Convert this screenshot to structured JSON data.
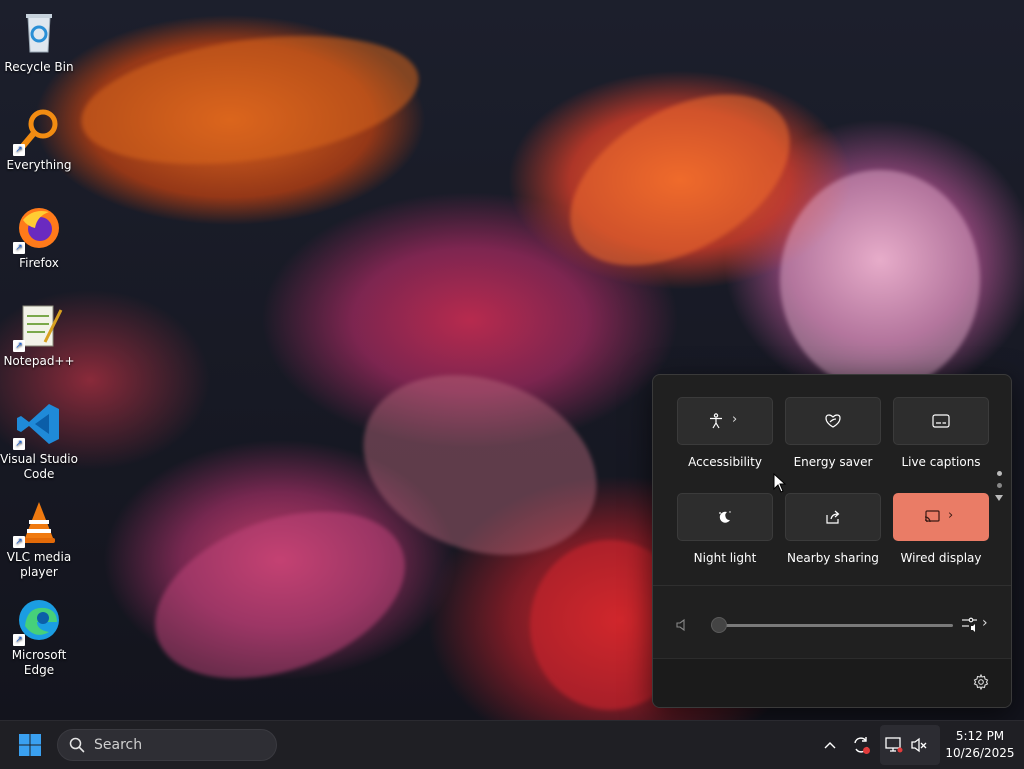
{
  "desktop": {
    "icons": [
      {
        "label": "Recycle Bin",
        "icon": "recycle-bin-icon"
      },
      {
        "label": "Everything",
        "icon": "everything-search-icon"
      },
      {
        "label": "Firefox",
        "icon": "firefox-icon"
      },
      {
        "label": "Notepad++",
        "icon": "notepad-plus-plus-icon"
      },
      {
        "label": "Visual Studio Code",
        "icon": "vscode-icon"
      },
      {
        "label": "VLC media player",
        "icon": "vlc-icon"
      },
      {
        "label": "Microsoft Edge",
        "icon": "edge-icon"
      }
    ]
  },
  "quick_settings": {
    "tiles": [
      {
        "label": "Accessibility",
        "icon": "accessibility-icon",
        "active": false,
        "has_chevron": true
      },
      {
        "label": "Energy saver",
        "icon": "energy-saver-icon",
        "active": false,
        "has_chevron": false
      },
      {
        "label": "Live captions",
        "icon": "live-captions-icon",
        "active": false,
        "has_chevron": false
      },
      {
        "label": "Night light",
        "icon": "night-light-icon",
        "active": false,
        "has_chevron": false
      },
      {
        "label": "Nearby sharing",
        "icon": "nearby-sharing-icon",
        "active": false,
        "has_chevron": false
      },
      {
        "label": "Wired display",
        "icon": "wired-display-icon",
        "active": true,
        "has_chevron": true
      }
    ],
    "volume": {
      "level": 0,
      "icon": "speaker-icon",
      "mixer_icon": "audio-mixer-icon"
    },
    "footer": {
      "settings_icon": "gear-icon"
    },
    "colors": {
      "panel": "#202020",
      "tile": "#2d2d2d",
      "active_tile": "#ea7c66"
    }
  },
  "taskbar": {
    "start_icon": "windows-start-icon",
    "search": {
      "placeholder": "Search"
    },
    "tray": {
      "overflow_icon": "chevron-up-icon",
      "icons": [
        "sync-alert-icon",
        "network-icon",
        "volume-muted-icon"
      ]
    },
    "clock": {
      "time": "5:12 PM",
      "date": "10/26/2025"
    }
  }
}
